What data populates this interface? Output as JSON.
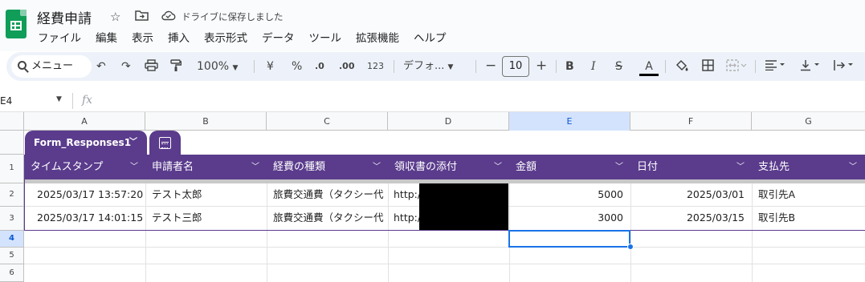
{
  "app": {
    "doc_title": "経費申請",
    "save_status": "ドライブに保存しました"
  },
  "menu": [
    "ファイル",
    "編集",
    "表示",
    "挿入",
    "表示形式",
    "データ",
    "ツール",
    "拡張機能",
    "ヘルプ"
  ],
  "toolbar": {
    "search_label": "メニュー",
    "zoom": "100%",
    "currency": "¥",
    "percent": "%",
    "decrease_decimal": ".0",
    "increase_decimal": ".00",
    "more_formats": "123",
    "font": "デフォ...",
    "font_size": "10"
  },
  "formula_bar": {
    "cell_ref": "E4",
    "fx": "fx"
  },
  "columns": [
    "A",
    "B",
    "C",
    "D",
    "E",
    "F",
    "G"
  ],
  "selected_column": "E",
  "rows": [
    "1",
    "2",
    "3",
    "4",
    "5",
    "6"
  ],
  "selected_row": "4",
  "table": {
    "name": "Form_Responses1",
    "headers": [
      "タイムスタンプ",
      "申請者名",
      "経費の種類",
      "領収書の添付",
      "金額",
      "日付",
      "支払先"
    ],
    "data": [
      [
        "2025/03/17 13:57:20",
        "テスト太郎",
        "旅費交通費（タクシー代",
        "http:/",
        "5000",
        "2025/03/01",
        "取引先A"
      ],
      [
        "2025/03/17 14:01:15",
        "テスト三郎",
        "旅費交通費（タクシー代",
        "http:/",
        "3000",
        "2025/03/15",
        "取引先B"
      ]
    ]
  },
  "colors": {
    "table_header": "#5a3b8c",
    "selection": "#1a73e8",
    "sheets_green": "#0f9d58"
  }
}
